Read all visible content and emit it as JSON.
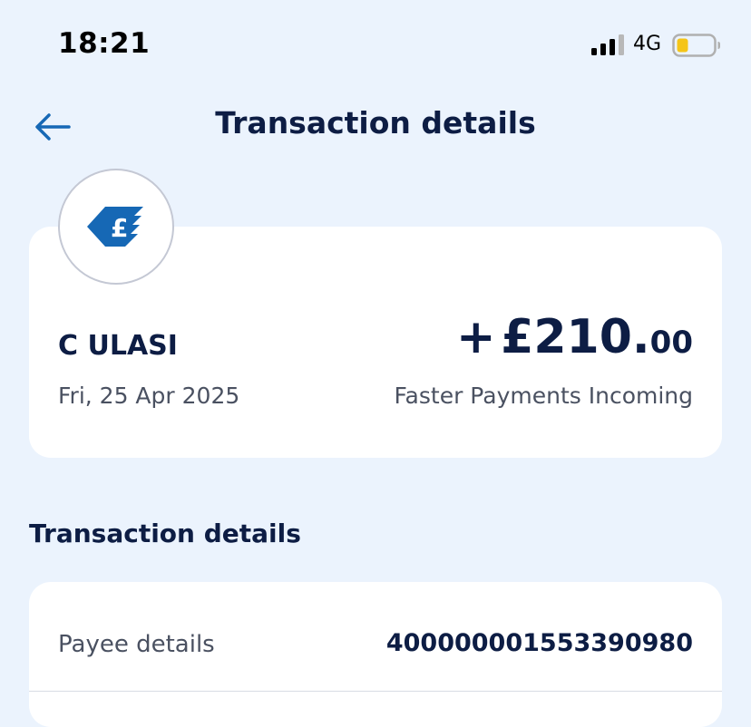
{
  "status_bar": {
    "time": "18:21",
    "network": "4G",
    "battery_color": "#f5c518"
  },
  "header": {
    "title": "Transaction details",
    "back_icon": "back-arrow-icon"
  },
  "summary": {
    "payee_name": "C ULASI",
    "date": "Fri, 25 Apr 2025",
    "amount_sign": "+",
    "amount_main": "£210.",
    "amount_pence": "00",
    "transaction_type": "Faster Payments Incoming",
    "avatar_icon": "faster-payment-pound-icon"
  },
  "details": {
    "section_title": "Transaction details",
    "rows": [
      {
        "label": "Payee details",
        "value": "400000001553390980"
      }
    ]
  },
  "colors": {
    "background": "#ebf3fd",
    "primary_text": "#0d1d44",
    "accent": "#1668b5"
  }
}
